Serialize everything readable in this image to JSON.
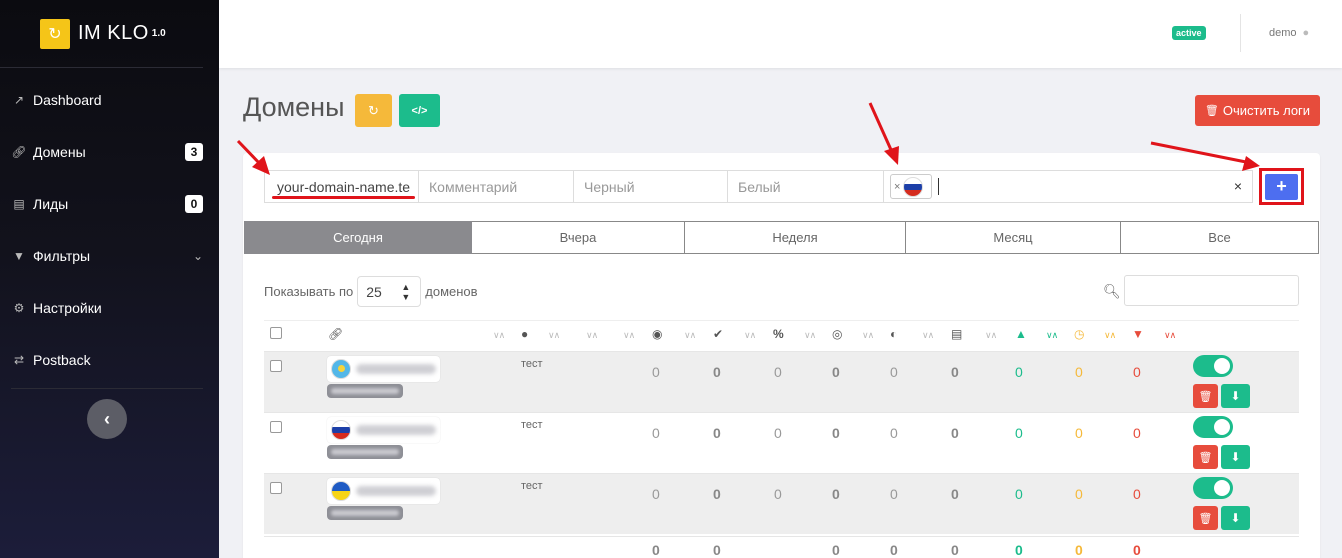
{
  "app": {
    "name": "IM KLO",
    "version": "1.0"
  },
  "sidebar": {
    "items": [
      {
        "label": "Dashboard",
        "icon": "chart-line-icon"
      },
      {
        "label": "Домены",
        "icon": "link-icon",
        "badge": "3"
      },
      {
        "label": "Лиды",
        "icon": "basket-icon",
        "badge": "0"
      },
      {
        "label": "Фильтры",
        "icon": "filter-icon"
      },
      {
        "label": "Настройки",
        "icon": "gear-icon"
      },
      {
        "label": "Postback",
        "icon": "exchange-icon"
      }
    ]
  },
  "topbar": {
    "status": "active",
    "user": "demo"
  },
  "page": {
    "title": "Домены",
    "clear_logs": "Очистить логи"
  },
  "form": {
    "domain_value": "your-domain-name.te",
    "comment_placeholder": "Комментарий",
    "black_placeholder": "Черный",
    "white_placeholder": "Белый",
    "country_tag": "ru",
    "add_label": "+"
  },
  "tabs": [
    "Сегодня",
    "Вчера",
    "Неделя",
    "Месяц",
    "Все"
  ],
  "active_tab": "Сегодня",
  "table": {
    "show_prefix": "Показывать по",
    "page_size": "25",
    "show_suffix": "доменов",
    "rows": [
      {
        "flag": "kz",
        "comment": "тест",
        "values": [
          "0",
          "0",
          "0",
          "0",
          "0",
          "0",
          "0",
          "0",
          "0"
        ]
      },
      {
        "flag": "ru",
        "comment": "тест",
        "values": [
          "0",
          "0",
          "0",
          "0",
          "0",
          "0",
          "0",
          "0",
          "0"
        ]
      },
      {
        "flag": "ua",
        "comment": "тест",
        "values": [
          "0",
          "0",
          "0",
          "0",
          "0",
          "0",
          "0",
          "0",
          "0"
        ]
      }
    ],
    "totals": [
      "0",
      "0",
      "0",
      "0",
      "0",
      "0",
      "0",
      "0"
    ]
  },
  "colors": {
    "accent_green": "#1cbc8c",
    "accent_yellow": "#f5b93a",
    "danger": "#e74c3c",
    "primary": "#4d6ef0",
    "annotation_red": "#e0141a"
  }
}
